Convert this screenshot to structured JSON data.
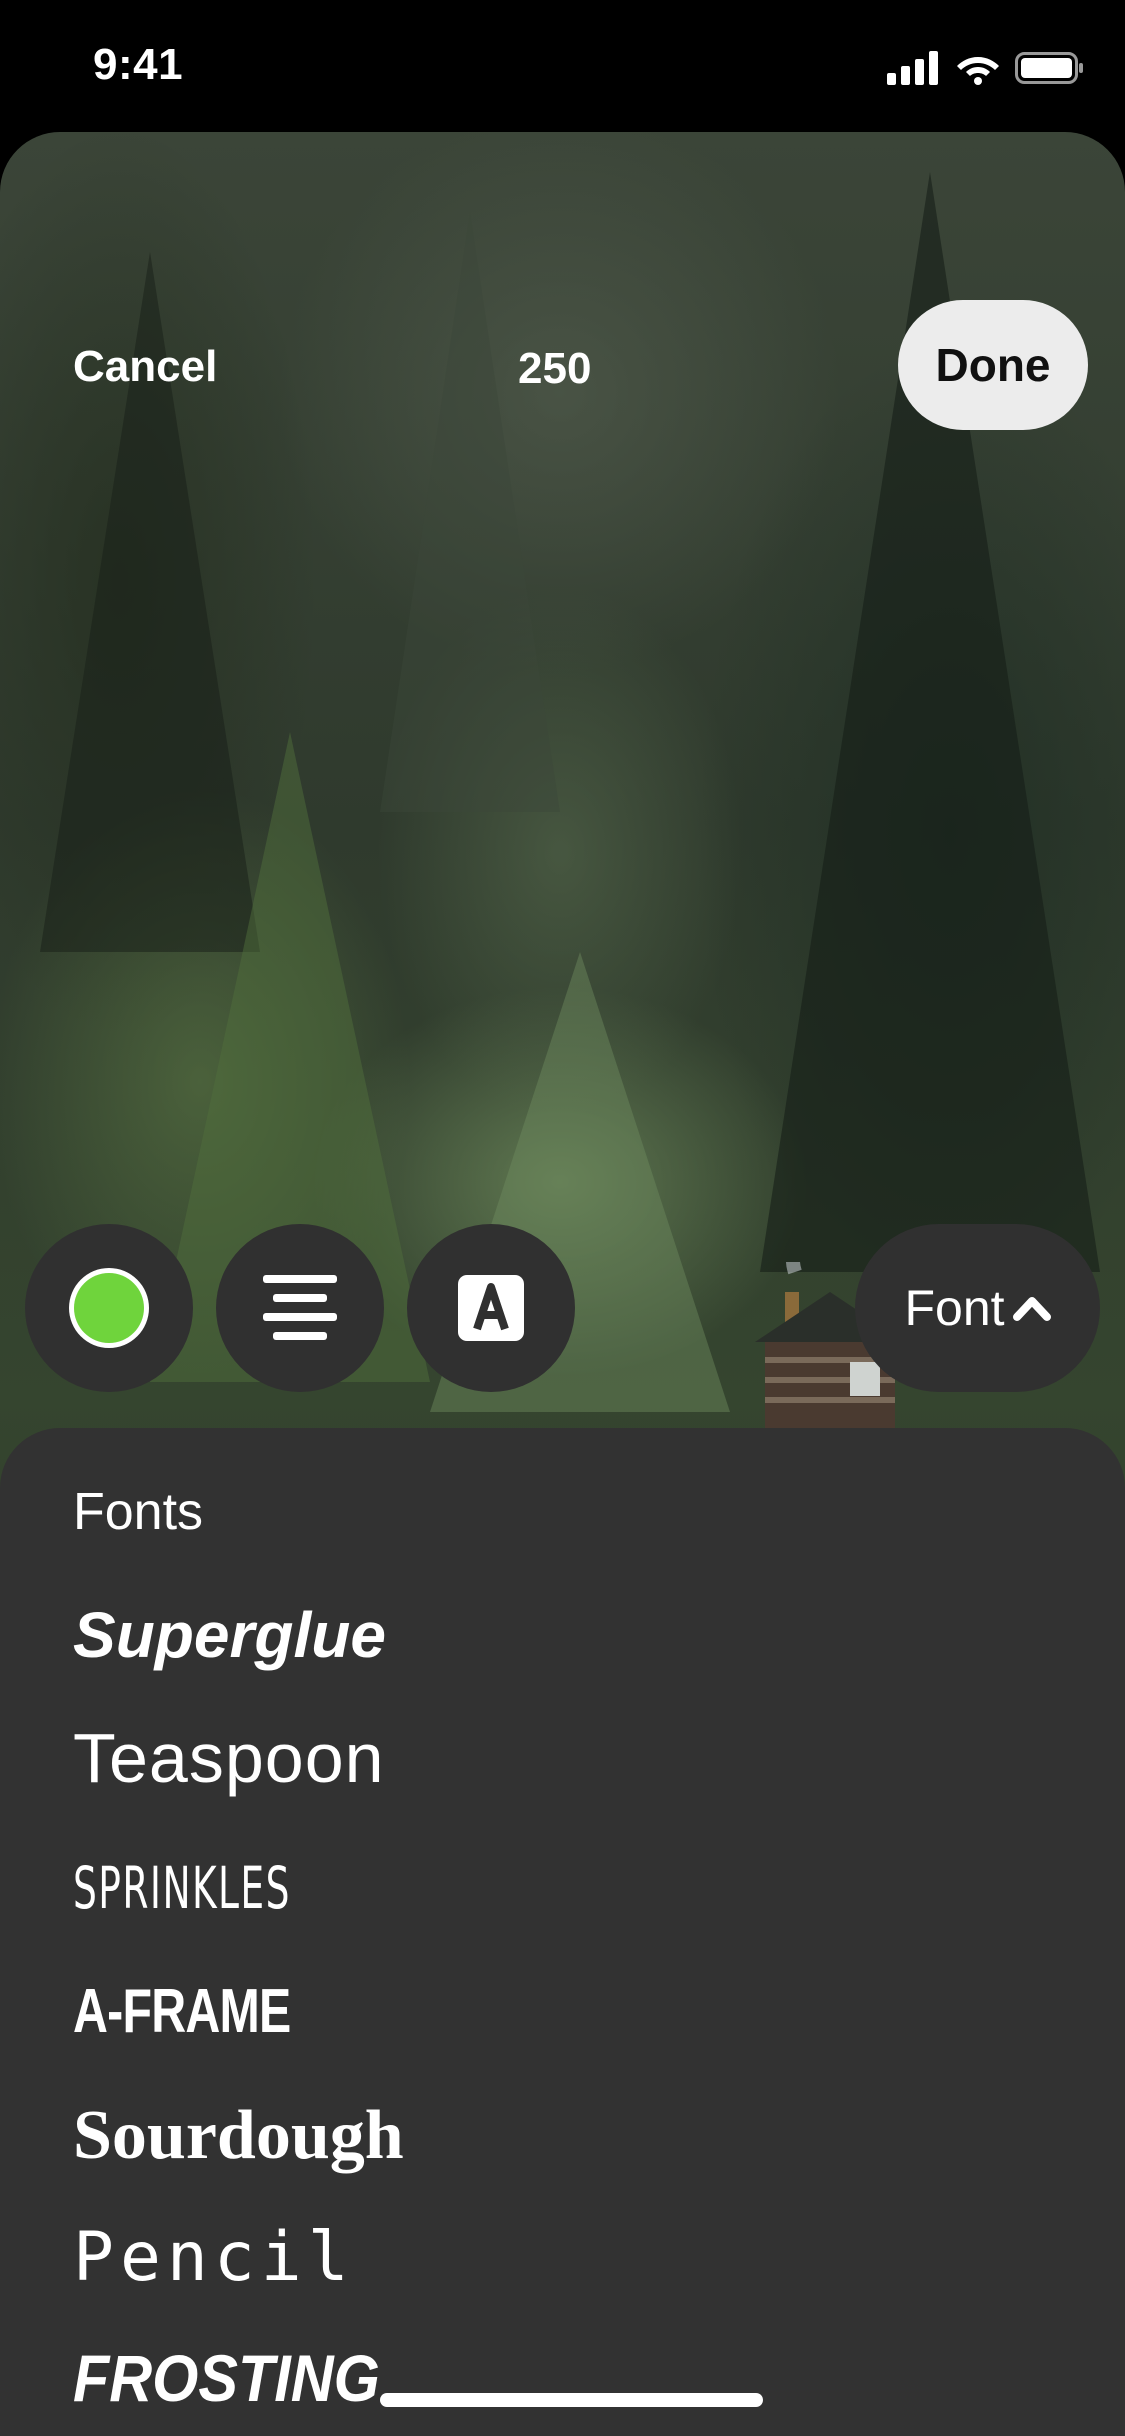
{
  "status_bar": {
    "time": "9:41",
    "icons": [
      "cellular-signal-icon",
      "wifi-icon",
      "battery-icon"
    ]
  },
  "header": {
    "cancel_label": "Cancel",
    "char_count": "250",
    "done_label": "Done"
  },
  "toolbar": {
    "color_button": {
      "icon": "color-swatch-icon",
      "selected_color": "#6fd43c"
    },
    "align_button": {
      "icon": "align-center-icon"
    },
    "style_button": {
      "icon": "text-style-icon",
      "glyph": "A"
    },
    "font_toggle": {
      "label": "Font",
      "icon": "chevron-up-icon"
    }
  },
  "fonts_sheet": {
    "title": "Fonts",
    "items": [
      {
        "label": "Superglue"
      },
      {
        "label": "Teaspoon"
      },
      {
        "label": "SPRINKLES"
      },
      {
        "label": "A-FRAME"
      },
      {
        "label": "Sourdough"
      },
      {
        "label": "Pencil"
      },
      {
        "label": "FROSTING"
      }
    ]
  }
}
